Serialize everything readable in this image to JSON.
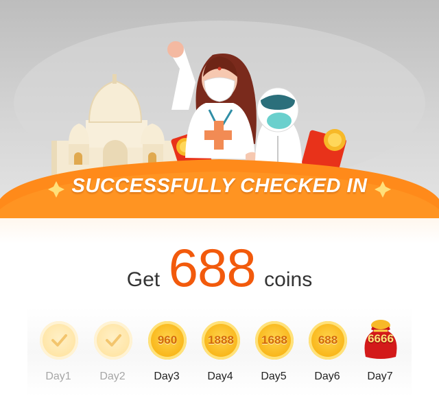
{
  "banner": {
    "title": "SUCCESSFULLY CHECKED IN"
  },
  "reward": {
    "prefix": "Get",
    "amount": "688",
    "suffix": "coins"
  },
  "days": [
    {
      "label": "Day1",
      "value": "",
      "claimed": true
    },
    {
      "label": "Day2",
      "value": "",
      "claimed": true
    },
    {
      "label": "Day3",
      "value": "960",
      "claimed": false
    },
    {
      "label": "Day4",
      "value": "1888",
      "claimed": false
    },
    {
      "label": "Day5",
      "value": "1688",
      "claimed": false
    },
    {
      "label": "Day6",
      "value": "688",
      "claimed": false
    },
    {
      "label": "Day7",
      "value": "6666",
      "claimed": false
    }
  ],
  "icons": {
    "claimed": "checkmark-icon",
    "bonus": "red-lucky-bag-icon",
    "coin": "gold-coin-icon"
  },
  "colors": {
    "accent": "#f25a0c",
    "banner": "#ff8a1a",
    "coin": "#f9b81d",
    "bag": "#d31a1a"
  }
}
